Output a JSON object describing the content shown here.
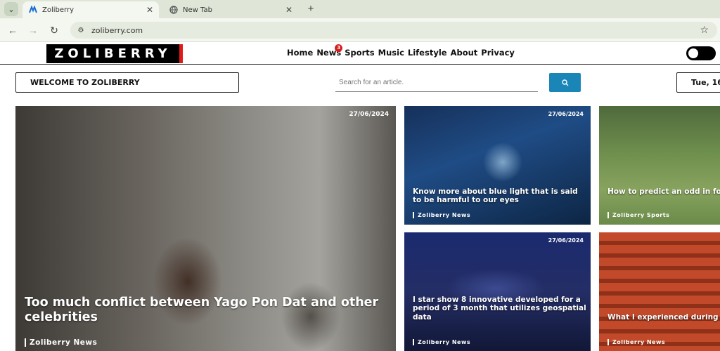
{
  "browser": {
    "tabs": [
      {
        "label": "Zoliberry",
        "favicon": "zoliberry-favicon"
      },
      {
        "label": "New Tab",
        "favicon": "globe-icon"
      }
    ],
    "url": "zoliberry.com"
  },
  "site": {
    "logo": "ZOLIBERRY",
    "nav": [
      "Home",
      "News",
      "Sports",
      "Music",
      "Lifestyle",
      "About",
      "Privacy"
    ],
    "news_badge": "3",
    "welcome": "WELCOME TO ZOLIBERRY",
    "search_placeholder": "Search for an article.",
    "date_text": "Tue, 16"
  },
  "articles": {
    "hero": {
      "date": "27/06/2024",
      "title": "Too much conflict between Yago Pon Dat and other celebrities",
      "category": "Zoliberry News"
    },
    "card1": {
      "date": "27/06/2024",
      "title": "Know more about blue light that is said to be harmful to our eyes",
      "category": "Zoliberry News"
    },
    "card2": {
      "title": "How to predict an odd in football games",
      "category": "Zoliberry Sports"
    },
    "card3": {
      "date": "27/06/2024",
      "title": "I star show 8 innovative developed for a period of 3 month that utilizes geospatial data",
      "category": "Zoliberry News"
    },
    "card4": {
      "title": "What I experienced during opening of Amahoro stadium",
      "category": "Zoliberry News"
    }
  },
  "colors": {
    "accent": "#1a86b8",
    "logo_bar": "#e11919",
    "badge": "#d41f1f"
  }
}
